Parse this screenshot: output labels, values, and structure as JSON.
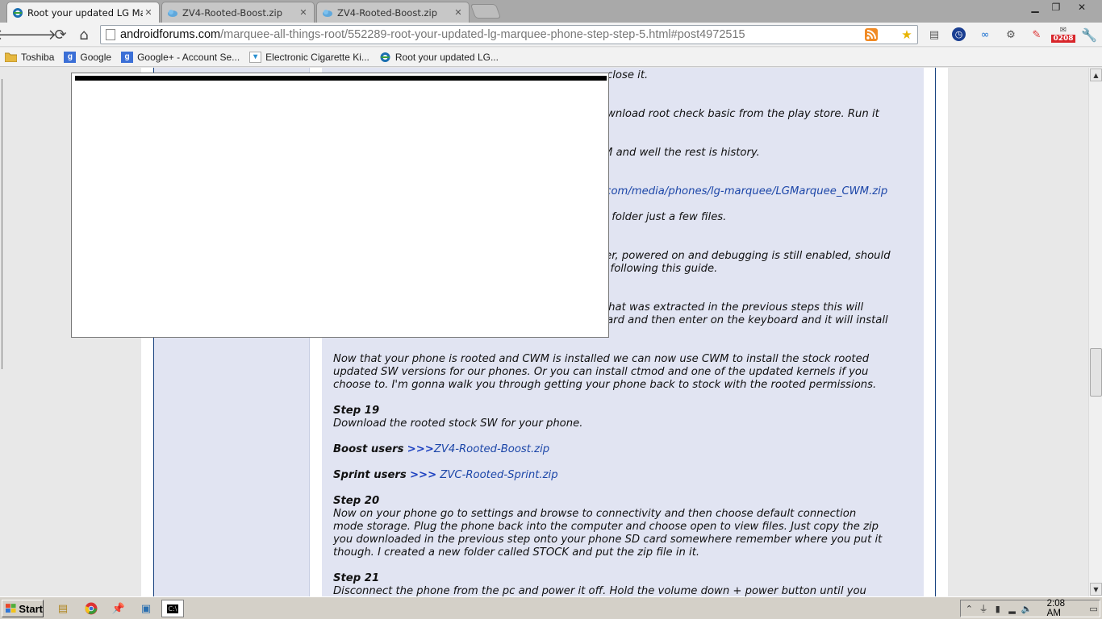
{
  "browser": {
    "tabs": [
      {
        "title": "Root your updated LG Marque",
        "active": true
      },
      {
        "title": "ZV4-Rooted-Boost.zip",
        "active": false
      },
      {
        "title": "ZV4-Rooted-Boost.zip",
        "active": false
      }
    ],
    "url_host": "androidforums.com",
    "url_path": "/marquee-all-things-root/552289-root-your-updated-lg-marquee-phone-step-step-5.html#post4972515",
    "extension_badge": "0208",
    "bookmarks": [
      {
        "label": "Toshiba",
        "icon": "folder-icon"
      },
      {
        "label": "Google",
        "icon": "google-icon"
      },
      {
        "label": "Google+ - Account Se...",
        "icon": "google-icon"
      },
      {
        "label": "Electronic Cigarette Ki...",
        "icon": "ecig-icon"
      },
      {
        "label": "Root your updated LG...",
        "icon": "forum-icon"
      }
    ]
  },
  "post": {
    "partial_lines": [
      "close it.",
      "ownload root check basic from the play store. Run it",
      "M and well the rest is history.",
      ".com/media/phones/lg-marquee/LGMarquee_CWM.zip",
      "a folder just a few files.",
      "ter, powered on and debugging is still enabled, should",
      "n following this guide.",
      "that was extracted in the previous steps this will",
      "oard and then enter on the keyboard and it will install"
    ],
    "intro": [
      "Now that your phone is rooted and CWM is installed we can now use CWM to install the stock rooted",
      "updated SW versions for our phones. Or you can install ctmod and one of the updated kernels if you",
      "choose to. I'm gonna walk you through getting your phone back to stock with the rooted permissions."
    ],
    "step19_title": "Step 19",
    "step19_text": "Download the rooted stock SW for your phone.",
    "boost_label": "Boost users",
    "boost_arrows": ">>>",
    "boost_link": "ZV4-Rooted-Boost.zip",
    "sprint_label": "Sprint users",
    "sprint_arrows": ">>>",
    "sprint_link": "ZVC-Rooted-Sprint.zip",
    "step20_title": "Step 20",
    "step20_text": [
      "Now on your phone go to settings and browse to connectivity and then choose default connection",
      "mode storage. Plug the phone back into the computer and choose open to view files. Just copy the zip",
      "you downloaded in the previous step onto your phone SD card somewhere remember where you put it",
      "though. I created a new folder called STOCK and put the zip file in it."
    ],
    "step21_title": "Step 21",
    "step21_text": "Disconnect the phone from the pc and power it off. Hold the volume down + power button until you"
  },
  "taskbar": {
    "start_label": "Start",
    "clock": "2:08 AM"
  }
}
